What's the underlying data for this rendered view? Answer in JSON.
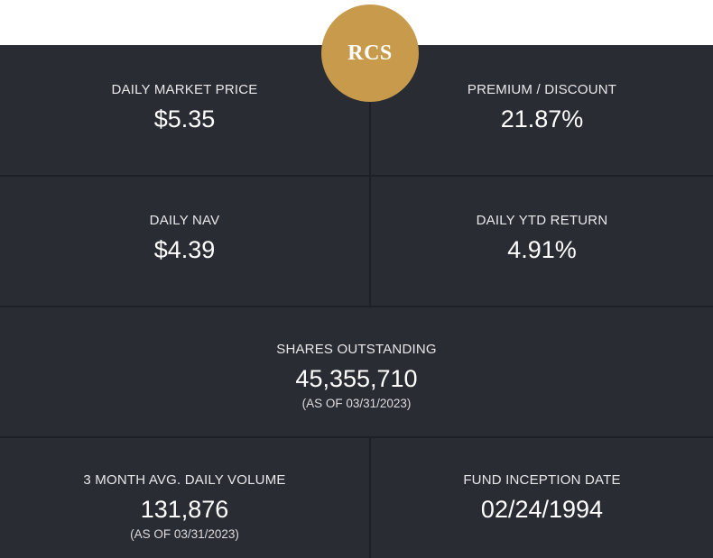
{
  "brand": {
    "logo_text": "RCS",
    "logo_color": "#c89b4c"
  },
  "theme": {
    "panel_bg": "#2a2c33",
    "divider": "#1f2026",
    "text": "#ffffff"
  },
  "stats": {
    "market_price": {
      "label": "DAILY MARKET PRICE",
      "value": "$5.35"
    },
    "premium_discount": {
      "label": "PREMIUM / DISCOUNT",
      "value": "21.87%"
    },
    "nav": {
      "label": "DAILY NAV",
      "value": "$4.39"
    },
    "ytd_return": {
      "label": "DAILY YTD RETURN",
      "value": "4.91%"
    },
    "shares_outstanding": {
      "label": "SHARES OUTSTANDING",
      "value": "45,355,710",
      "note": "(AS OF 03/31/2023)"
    },
    "avg_volume": {
      "label": "3 MONTH AVG. DAILY VOLUME",
      "value": "131,876",
      "note": "(AS OF 03/31/2023)"
    },
    "inception": {
      "label": "FUND INCEPTION DATE",
      "value": "02/24/1994"
    }
  }
}
